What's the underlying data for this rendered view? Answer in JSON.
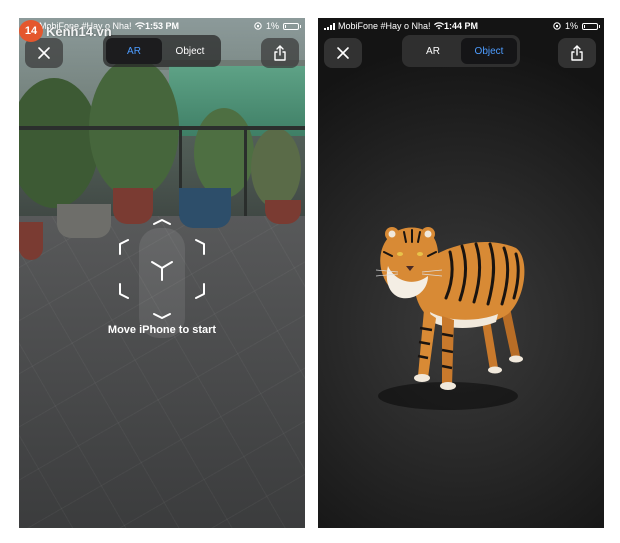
{
  "watermark": {
    "badge": "14",
    "text": "Kenh14.vn"
  },
  "ar_screen": {
    "status": {
      "carrier": "MobiFone #Hay o Nha!",
      "time": "1:53 PM",
      "battery": "1%",
      "battery_level": 0.05
    },
    "close_icon": "close-icon",
    "segment": [
      {
        "label": "AR",
        "active": true
      },
      {
        "label": "Object",
        "active": false
      }
    ],
    "share_icon": "share-icon",
    "hint": "Move iPhone to start"
  },
  "object_screen": {
    "status": {
      "carrier": "MobiFone #Hay o Nha!",
      "time": "1:44 PM",
      "battery": "1%",
      "battery_level": 0.05
    },
    "close_icon": "close-icon",
    "segment": [
      {
        "label": "AR",
        "active": false
      },
      {
        "label": "Object",
        "active": true
      }
    ],
    "share_icon": "share-icon"
  },
  "colors": {
    "accent": "#4d9cff",
    "tiger_orange": "#d88a35",
    "dark_bg": "#1e1e1e"
  }
}
